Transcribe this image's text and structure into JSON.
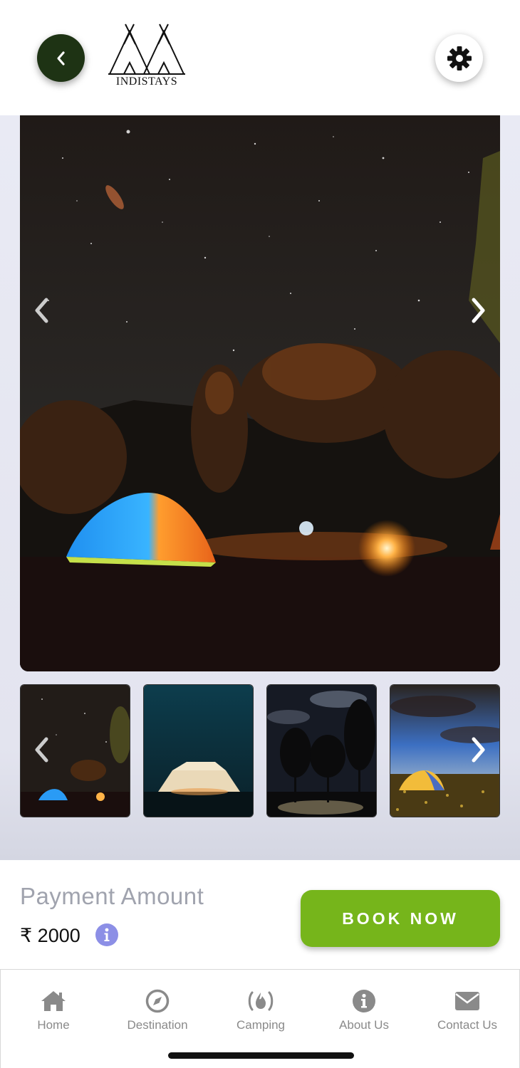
{
  "header": {
    "back_icon": "chevron-left-icon",
    "logo_text": "INDISTAYS",
    "settings_icon": "gear-icon"
  },
  "gallery": {
    "main_image": "night-camping-tent-campfire-stars",
    "thumbnails": [
      "night-camping-tent-campfire",
      "glowing-tent-night",
      "trees-starry-night-sky",
      "tent-field-blue-sky"
    ],
    "prev_icon": "chevron-left-icon",
    "next_icon": "chevron-right-icon"
  },
  "payment": {
    "title": "Payment Amount",
    "amount": "₹ 2000",
    "info_icon": "info-icon",
    "book_button": "BOOK NOW"
  },
  "tabbar": {
    "items": [
      {
        "label": "Home",
        "icon": "home-icon"
      },
      {
        "label": "Destination",
        "icon": "compass-icon"
      },
      {
        "label": "Camping",
        "icon": "campfire-icon"
      },
      {
        "label": "About Us",
        "icon": "info-icon"
      },
      {
        "label": "Contact Us",
        "icon": "envelope-icon"
      }
    ]
  },
  "colors": {
    "back_button": "#1e3314",
    "book_button": "#76b51b",
    "info_badge": "#8c8fe6",
    "gallery_bg": "#e9eaf4",
    "tab_label": "#8a8a8a"
  }
}
